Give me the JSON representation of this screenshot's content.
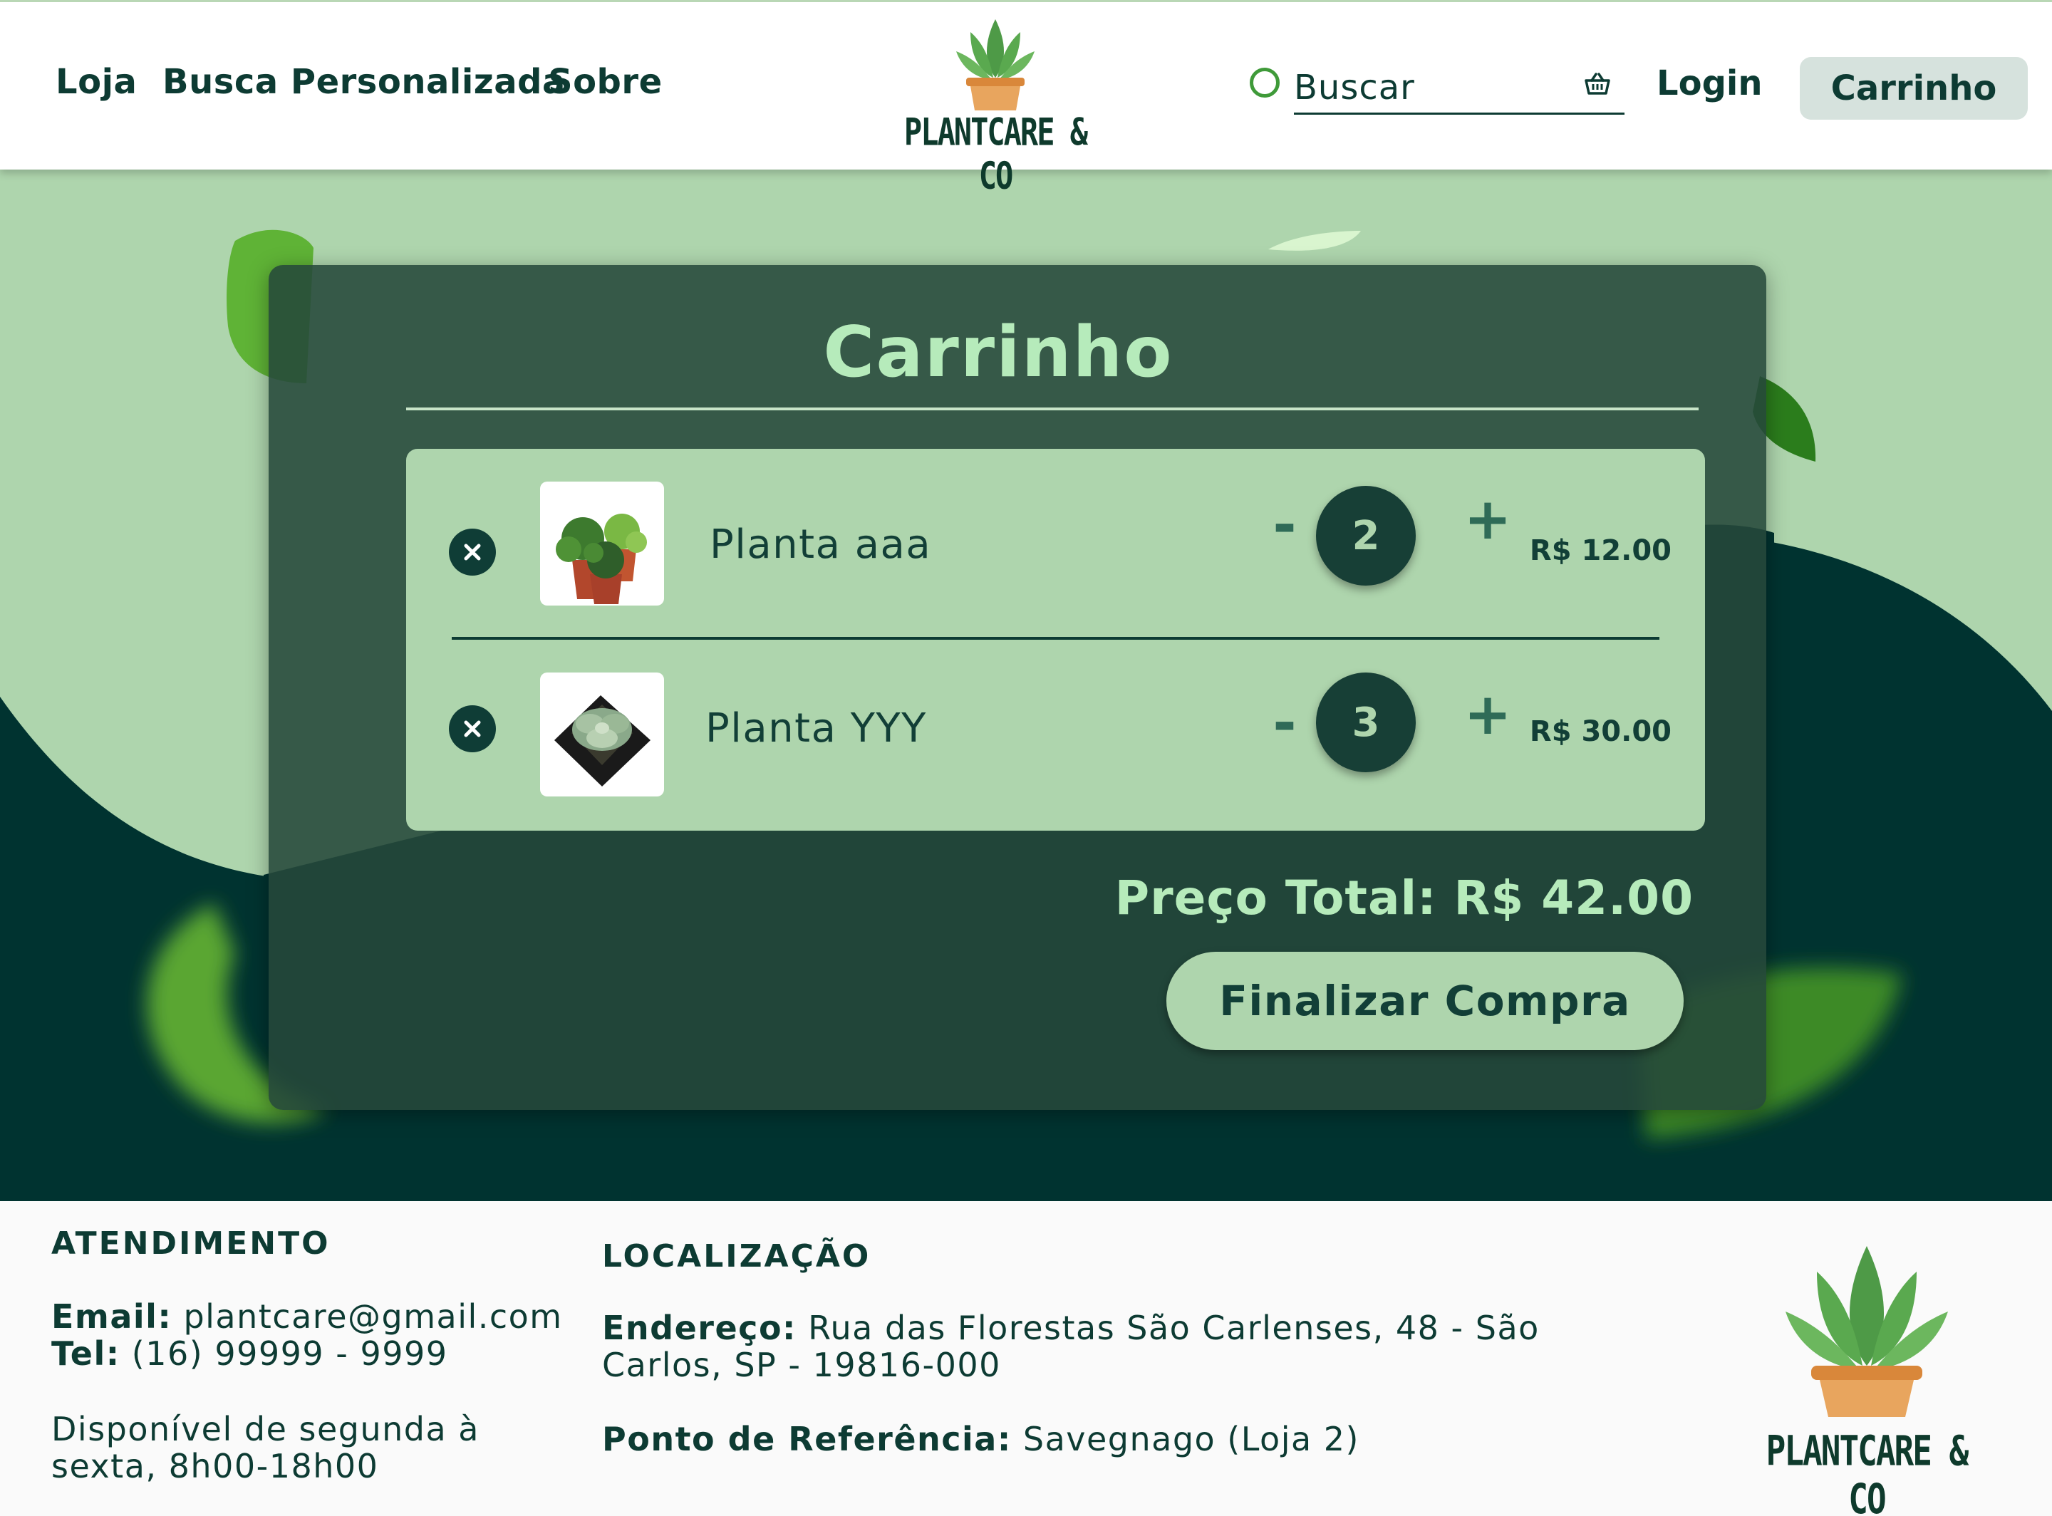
{
  "header": {
    "nav": [
      "Loja",
      "Busca Personalizada",
      "Sobre"
    ],
    "logo_text": "PLANTCARE & CO",
    "search_placeholder": "Buscar",
    "login": "Login",
    "cart": "Carrinho"
  },
  "cart": {
    "title": "Carrinho",
    "items": [
      {
        "name": "Planta aaa",
        "quantity": "2",
        "price": "R$ 12.00",
        "minus": "-",
        "plus": "+"
      },
      {
        "name": "Planta YYY",
        "quantity": "3",
        "price": "R$ 30.00",
        "minus": "-",
        "plus": "+"
      }
    ],
    "total": "Preço Total: R$ 42.00",
    "checkout": "Finalizar Compra"
  },
  "footer": {
    "service_heading": "ATENDIMENTO",
    "email_label": "Email:",
    "email": "plantcare@gmail.com",
    "tel_label": "Tel:",
    "tel": "(16) 99999 - 9999",
    "hours_line1": "Disponível de segunda à",
    "hours_line2": "sexta, 8h00-18h00",
    "location_heading": "LOCALIZAÇÃO",
    "address_label": "Endereço:",
    "address_line1": "Rua das Florestas São Carlenses, 48   - São",
    "address_line2": "Carlos, SP - 19816-000",
    "reference_label": "Ponto de Referência:",
    "reference": "Savegnago (Loja 2)",
    "logo_text": "PLANTCARE & CO"
  },
  "colors": {
    "dark_green": "#0d3b33",
    "light_green": "#aed5ad",
    "panel": "#26483a",
    "accent_text": "#b6ebbb"
  },
  "icons": [
    "plant-logo-icon",
    "search-circle-icon",
    "basket-icon",
    "remove-icon"
  ]
}
